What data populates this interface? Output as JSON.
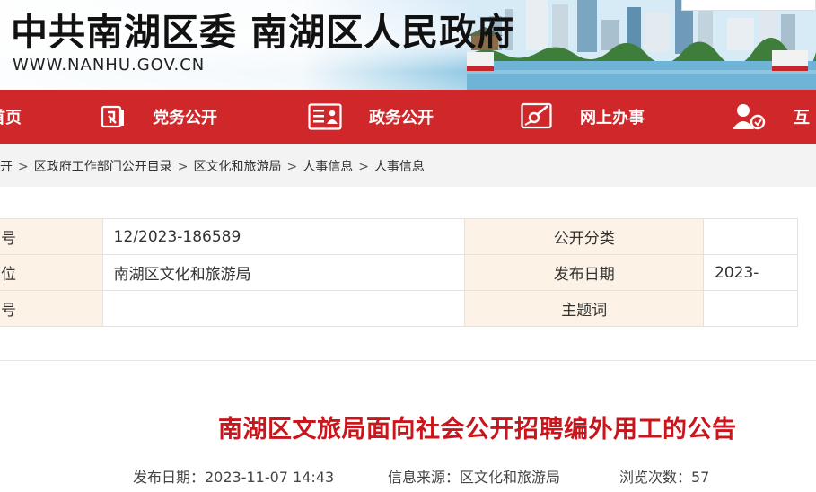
{
  "header": {
    "title": "中共南湖区委 南湖区人民政府",
    "url": "WWW.NANHU.GOV.CN"
  },
  "nav": {
    "items": [
      {
        "label": "首页",
        "icon": "home"
      },
      {
        "label": "党务公开",
        "icon": "party-emblem-icon"
      },
      {
        "label": "政务公开",
        "icon": "document-icon"
      },
      {
        "label": "网上办事",
        "icon": "service-icon"
      },
      {
        "label": "互",
        "icon": "user-interaction-icon"
      }
    ]
  },
  "breadcrumb": [
    "开",
    "区政府工作部门公开目录",
    "区文化和旅游局",
    "人事信息",
    "人事信息"
  ],
  "info_table": {
    "rows": [
      {
        "label_left": "号",
        "value_left": "12/2023-186589",
        "label_right": "公开分类",
        "value_right": ""
      },
      {
        "label_left": "位",
        "value_left": "南湖区文化和旅游局",
        "label_right": "发布日期",
        "value_right": "2023-"
      },
      {
        "label_left": "号",
        "value_left": "",
        "label_right": "主题词",
        "value_right": ""
      }
    ]
  },
  "article": {
    "title": "南湖区文旅局面向社会公开招聘编外用工的公告",
    "publish_date": "发布日期：2023-11-07 14:43",
    "source": "信息来源：区文化和旅游局",
    "views": "浏览次数：57"
  },
  "colors": {
    "nav_bg": "#d0282a",
    "title_red": "#c8161d",
    "label_bg": "#fcf2e6"
  }
}
